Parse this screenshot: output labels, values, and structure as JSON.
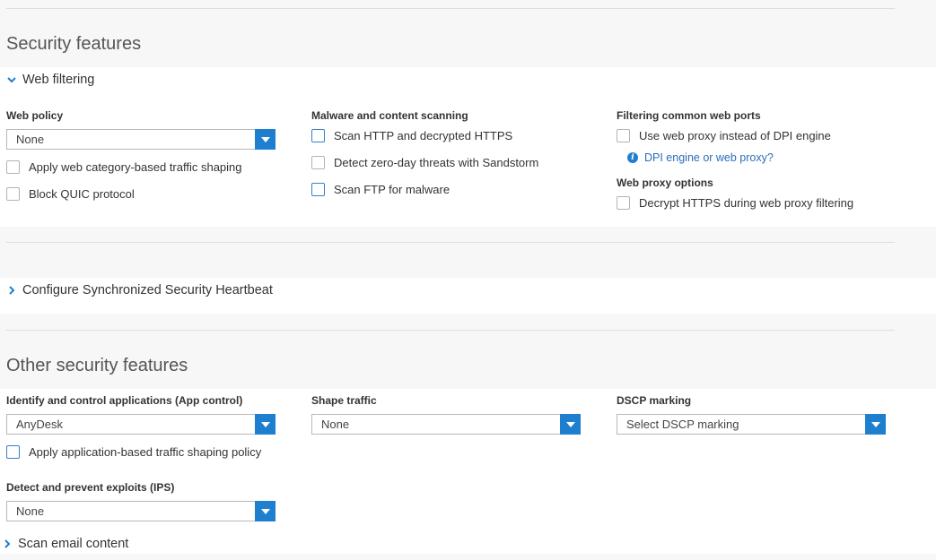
{
  "sections": {
    "security": {
      "title": "Security features",
      "web_filtering": {
        "header": "Web filtering",
        "expanded": true,
        "web_policy": {
          "label": "Web policy",
          "value": "None",
          "checkboxes": [
            "Apply web category-based traffic shaping",
            "Block QUIC protocol"
          ]
        },
        "malware": {
          "label": "Malware and content scanning",
          "checkboxes": [
            "Scan HTTP and decrypted HTTPS",
            "Detect zero-day threats with Sandstorm",
            "Scan FTP for malware"
          ]
        },
        "ports": {
          "label": "Filtering common web ports",
          "checkbox": "Use web proxy instead of DPI engine",
          "link": "DPI engine or web proxy?"
        },
        "proxy": {
          "label": "Web proxy options",
          "checkbox": "Decrypt HTTPS during web proxy filtering"
        }
      },
      "heartbeat": {
        "header": "Configure Synchronized Security Heartbeat",
        "expanded": false
      }
    },
    "other": {
      "title": "Other security features",
      "app_control": {
        "label": "Identify and control applications (App control)",
        "value": "AnyDesk",
        "checkbox": "Apply application-based traffic shaping policy"
      },
      "shape_traffic": {
        "label": "Shape traffic",
        "value": "None"
      },
      "dscp": {
        "label": "DSCP marking",
        "value": "Select DSCP marking"
      },
      "ips": {
        "label": "Detect and prevent exploits (IPS)",
        "value": "None"
      },
      "email": {
        "header": "Scan email content",
        "expanded": false
      }
    }
  },
  "colors": {
    "accent": "#1f7fcf",
    "link": "#2a6eb8",
    "background": "#f7f7f7",
    "panel": "#ffffff"
  },
  "icons": {
    "expanded": "chevron-down-icon",
    "collapsed": "chevron-right-icon",
    "dropdown": "dropdown-arrow-icon",
    "info": "info-icon"
  }
}
